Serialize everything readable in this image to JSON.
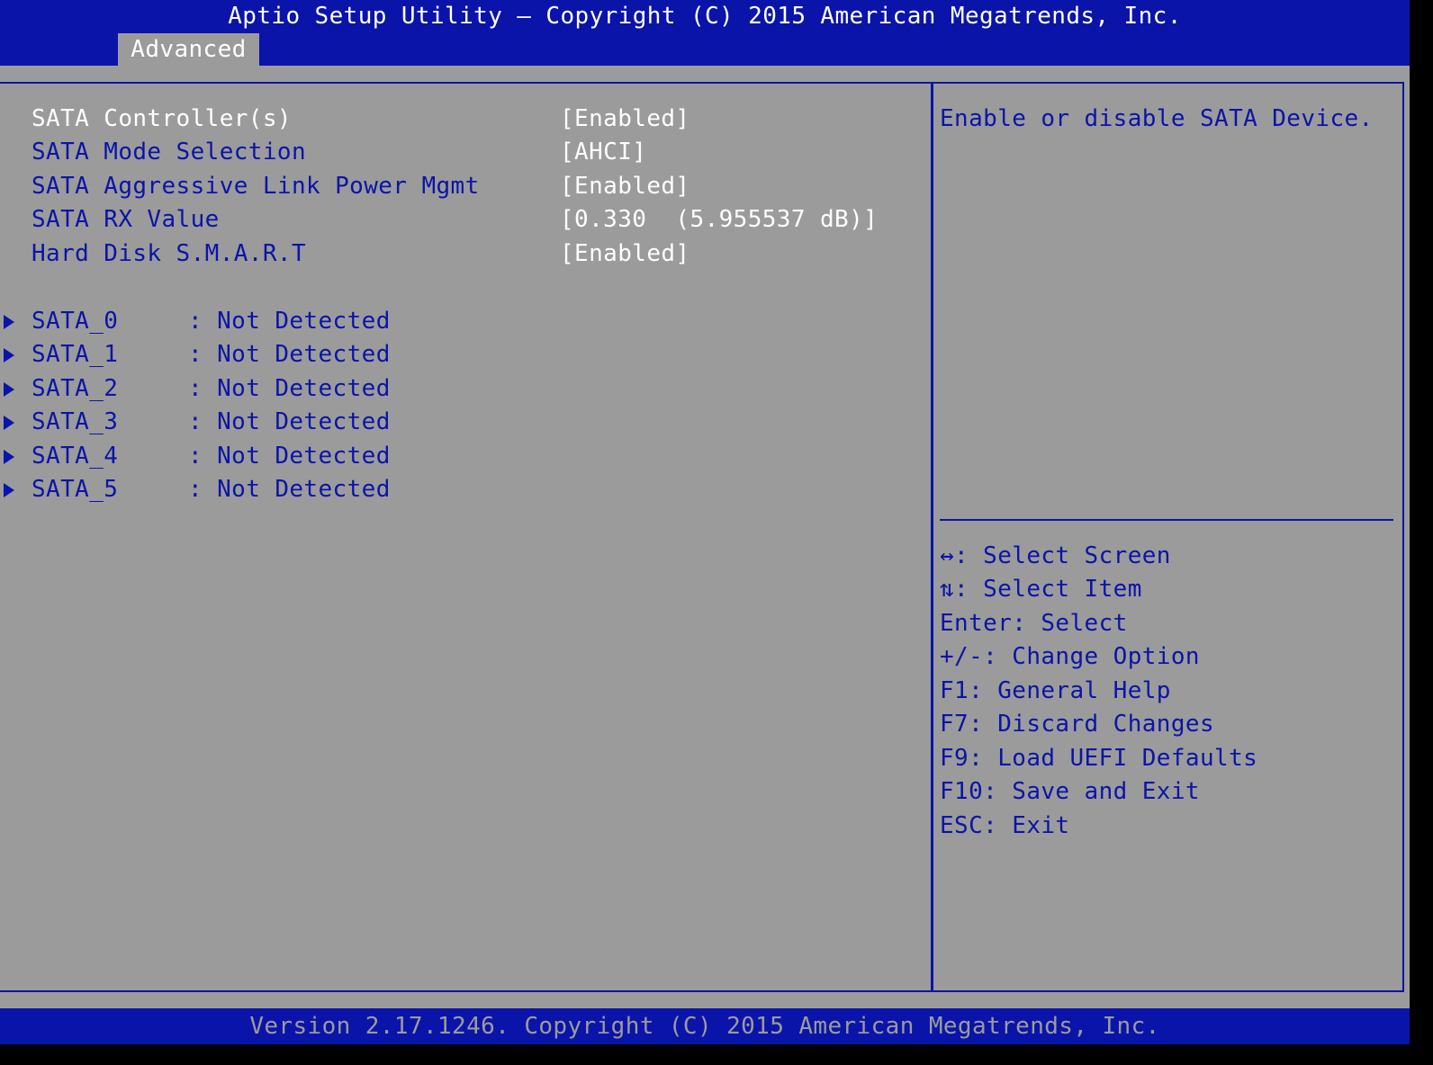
{
  "header": {
    "title": "Aptio Setup Utility – Copyright (C) 2015 American Megatrends, Inc.",
    "active_tab": "Advanced"
  },
  "settings": [
    {
      "label": "SATA Controller(s)",
      "value": "[Enabled]",
      "selected": true
    },
    {
      "label": "SATA Mode Selection",
      "value": "[AHCI]"
    },
    {
      "label": "SATA Aggressive Link Power Mgmt",
      "value": "[Enabled]"
    },
    {
      "label": "SATA RX Value",
      "value": "[0.330  (5.955537 dB)]"
    },
    {
      "label": "Hard Disk S.M.A.R.T",
      "value": "[Enabled]"
    }
  ],
  "ports": [
    {
      "label": "SATA_0",
      "status": ": Not Detected"
    },
    {
      "label": "SATA_1",
      "status": ": Not Detected"
    },
    {
      "label": "SATA_2",
      "status": ": Not Detected"
    },
    {
      "label": "SATA_3",
      "status": ": Not Detected"
    },
    {
      "label": "SATA_4",
      "status": ": Not Detected"
    },
    {
      "label": "SATA_5",
      "status": ": Not Detected"
    }
  ],
  "help": {
    "text": "Enable or disable SATA Device."
  },
  "keys": [
    "↔: Select Screen",
    "⇅: Select Item",
    "Enter: Select",
    "+/-: Change Option",
    "F1: General Help",
    "F7: Discard Changes",
    "F9: Load UEFI Defaults",
    "F10: Save and Exit",
    "ESC: Exit"
  ],
  "footer": {
    "version": "Version 2.17.1246. Copyright (C) 2015 American Megatrends, Inc."
  },
  "colors": {
    "bios_blue": "#0b14a8",
    "bios_gray": "#9b9b9b",
    "highlight_white": "#ffffff"
  }
}
